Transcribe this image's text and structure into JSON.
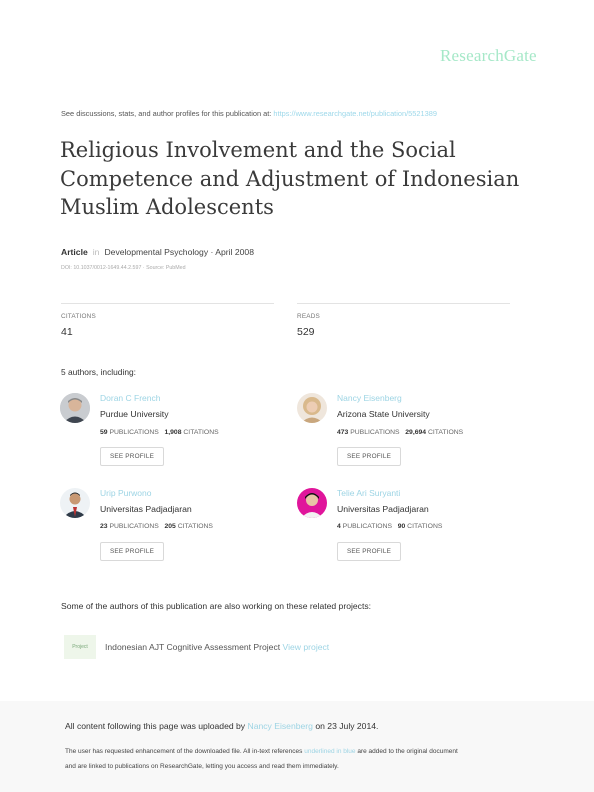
{
  "brand": {
    "logo": "ResearchGate",
    "logo_color": "#a6e8c8"
  },
  "header": {
    "intro": "See discussions, stats, and author profiles for this publication at:",
    "url": "https://www.researchgate.net/publication/5521389"
  },
  "article": {
    "title_lines": [
      "Religious Involvement and the Social",
      "Competence and Adjustment of Indonesian",
      "Muslim Adolescents"
    ],
    "type": "Article",
    "in": "in",
    "journal": "Developmental Psychology · April 2008",
    "doi": "DOI: 10.1037/0012-1649.44.2.597 · Source: PubMed"
  },
  "stats": {
    "citations_label": "CITATIONS",
    "citations": "41",
    "reads_label": "READS",
    "reads": "529"
  },
  "authors_heading_count": "5 authors",
  "authors_heading_rest": ", including:",
  "authors": [
    {
      "name": "Doran C French",
      "inst": "Purdue University",
      "pubs": "59",
      "pubs_label": "PUBLICATIONS",
      "cites": "1,908",
      "cites_label": "CITATIONS",
      "button": "SEE PROFILE",
      "avatar_bg": "#6b7280"
    },
    {
      "name": "Nancy Eisenberg",
      "inst": "Arizona State University",
      "pubs": "473",
      "pubs_label": "PUBLICATIONS",
      "cites": "29,694",
      "cites_label": "CITATIONS",
      "button": "SEE PROFILE",
      "avatar_bg": "#d9c2a6"
    },
    {
      "name": "Urip Purwono",
      "inst": "Universitas Padjadjaran",
      "pubs": "23",
      "pubs_label": "PUBLICATIONS",
      "cites": "205",
      "cites_label": "CITATIONS",
      "button": "SEE PROFILE",
      "avatar_bg": "#e8eef2"
    },
    {
      "name": "Telie Ari Suryanti",
      "inst": "Universitas Padjadjaran",
      "pubs": "4",
      "pubs_label": "PUBLICATIONS",
      "cites": "90",
      "cites_label": "CITATIONS",
      "button": "SEE PROFILE",
      "avatar_bg": "#e0159b"
    }
  ],
  "related": {
    "heading": "Some of the authors of this publication are also working on these related projects:",
    "icon_label": "Project",
    "project_title": "Indonesian AJT Cognitive Assessment Project",
    "project_link": "View project"
  },
  "footer": {
    "upload_prefix": "All content following this page was uploaded by",
    "uploader": "Nancy Eisenberg",
    "upload_suffix": "on 23 July 2014.",
    "note_1": "The user has requested enhancement of the downloaded file. All in-text references",
    "note_link": "underlined in blue",
    "note_2": "are added to the original document",
    "note_3": "and are linked to publications on ResearchGate, letting you access and read them immediately."
  }
}
